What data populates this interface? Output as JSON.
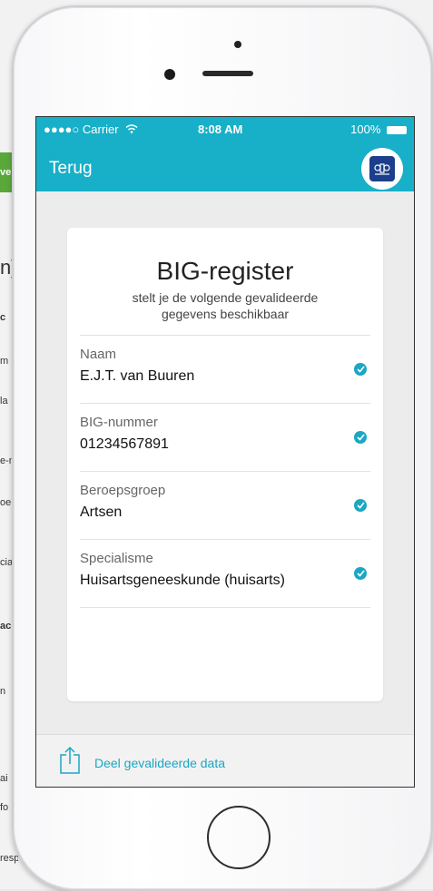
{
  "background_page": {
    "fragments": [
      "n]",
      "c",
      "m",
      "la",
      "e-n",
      "oe",
      "cia",
      "ac",
      "n",
      "ai",
      "fo",
      "resp"
    ],
    "green_button_text": "ve"
  },
  "status_bar": {
    "carrier": "●●●●○ Carrier",
    "time": "8:08 AM",
    "battery": "100%"
  },
  "nav": {
    "back_label": "Terug"
  },
  "card": {
    "title": "BIG-register",
    "subtitle": "stelt je de volgende gevalideerde gegevens beschikbaar",
    "fields": [
      {
        "label": "Naam",
        "value": "E.J.T. van Buuren"
      },
      {
        "label": "BIG-nummer",
        "value": "01234567891"
      },
      {
        "label": "Beroepsgroep",
        "value": "Artsen"
      },
      {
        "label": "Specialisme",
        "value": "Huisartsgeneeskunde (huisarts)"
      }
    ]
  },
  "footer": {
    "share_label": "Deel gevalideerde data"
  },
  "colors": {
    "accent": "#17b0c8",
    "check": "#1aa7c4",
    "emblem": "#1c3f8c"
  },
  "icons": {
    "wifi": "wifi-icon",
    "battery": "battery-icon",
    "emblem": "emblem-icon",
    "check": "checkmark-icon",
    "share": "share-icon"
  }
}
